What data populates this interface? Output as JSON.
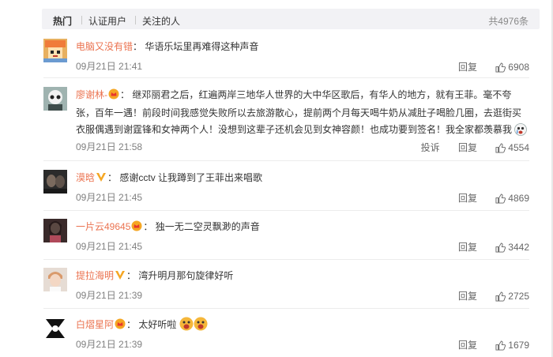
{
  "tabs": [
    {
      "label": "热门",
      "active": true
    },
    {
      "label": "认证用户",
      "active": false
    },
    {
      "label": "关注的人",
      "active": false
    }
  ],
  "total_count": "共4976条",
  "comments": [
    {
      "user": "电脑又没有错",
      "text": "华语乐坛里再难得这种声音",
      "time": "09月21日 21:41",
      "reply_label": "回复",
      "likes": "6908"
    },
    {
      "user": "廖谢林-",
      "text_lines": [
        "继邓丽君之后，红遍两岸三地华人世界的大中华区歌后，有华人的地方，就有王菲。毫不夸",
        "张，百年一遇！前段时间我感觉失败所以去旅游散心，提前两个月每天喝牛奶从减肚子喝脸几圈，去逛街买",
        "衣服偶遇到谢霆锋和女神两个人！没想到这辈子还机会见到女神容颜！也成功要到签名！我全家都羡慕我"
      ],
      "time": "09月21日 21:58",
      "report_label": "投诉",
      "reply_label": "回复",
      "likes": "4554"
    },
    {
      "user": "漠晗",
      "text": "感谢cctv 让我蹲到了王菲出来唱歌",
      "time": "09月21日 21:45",
      "reply_label": "回复",
      "likes": "4869"
    },
    {
      "user": "一片云49645",
      "text": "独一无二空灵飘渺的声音",
      "time": "09月21日 21:45",
      "reply_label": "回复",
      "likes": "3442"
    },
    {
      "user": "提拉海明",
      "text": "湾升明月那句旋律好听",
      "time": "09月21日 21:39",
      "reply_label": "回复",
      "likes": "2725"
    },
    {
      "user": "白熠星阿",
      "text": "太好听啦",
      "time": "09月21日 21:39",
      "reply_label": "回复",
      "likes": "1679"
    }
  ],
  "colors": {
    "username": "#eb7350",
    "meta": "#808080",
    "tab_bg": "#f2f2f5",
    "vip_orange": "#f5a623"
  }
}
